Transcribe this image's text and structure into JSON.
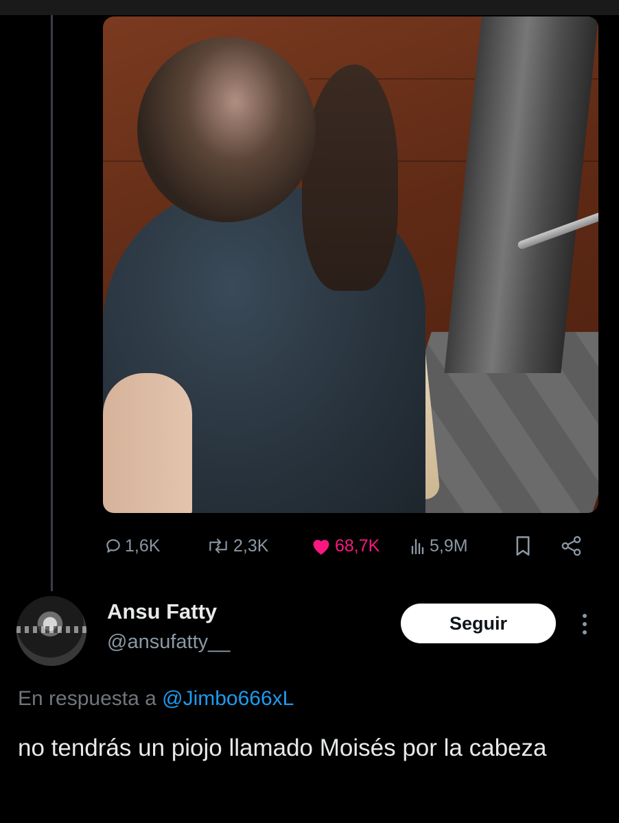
{
  "tweet": {
    "stats": {
      "replies": "1,6K",
      "retweets": "2,3K",
      "likes": "68,7K",
      "views": "5,9M"
    },
    "icons": {
      "reply": "reply-bubble-icon",
      "retweet": "retweet-icon",
      "like": "heart-filled-icon",
      "views": "bar-chart-icon",
      "bookmark": "bookmark-icon",
      "share": "share-icon"
    },
    "colors": {
      "like": "#f91880",
      "muted": "#8b98a5"
    }
  },
  "reply": {
    "display_name": "Ansu Fatty",
    "handle": "@ansufatty__",
    "follow_label": "Seguir",
    "in_reply_prefix": "En respuesta a",
    "in_reply_mention": "@Jimbo666xL",
    "text": "no tendrás un piojo llamado Moisés por la cabeza",
    "colors": {
      "mention": "#1d9bf0",
      "follow_bg": "#ffffff"
    }
  }
}
